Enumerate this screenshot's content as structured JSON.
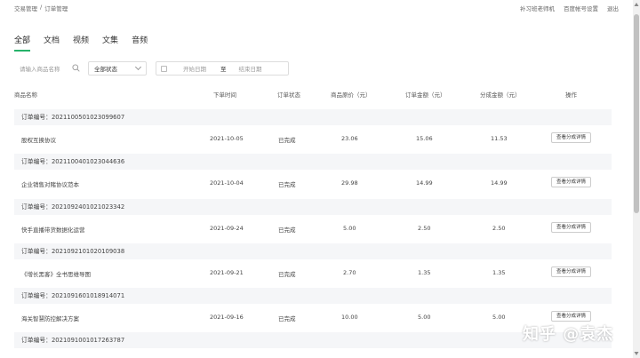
{
  "breadcrumb": {
    "root": "交易管理",
    "sep": "/",
    "current": "订单管理"
  },
  "top_links": [
    "补习班老师机",
    "百度帐号设置",
    "退出"
  ],
  "tabs": [
    {
      "label": "全部",
      "active": true
    },
    {
      "label": "文档"
    },
    {
      "label": "视频"
    },
    {
      "label": "文集"
    },
    {
      "label": "音频"
    }
  ],
  "filters": {
    "search_placeholder": "请输入商品名称",
    "status_select": "全部状态",
    "date_start_placeholder": "开始日期",
    "date_sep": "至",
    "date_end_placeholder": "结束日期"
  },
  "columns": [
    "商品名称",
    "下单时间",
    "订单状态",
    "商品原价（元）",
    "订单金额（元）",
    "分成金额（元）",
    "操作"
  ],
  "orders": [
    {
      "order_no": "订单编号：2021100501023099607",
      "name": "股权互换协议",
      "time": "2021-10-05",
      "status": "已完成",
      "price": "23.06",
      "amount": "15.06",
      "share": "11.53",
      "action": "查看分成详情"
    },
    {
      "order_no": "订单编号：2021100401023044636",
      "name": "企业销售对赌协议范本",
      "time": "2021-10-04",
      "status": "已完成",
      "price": "29.98",
      "amount": "14.99",
      "share": "14.99",
      "action": "查看分成详情"
    },
    {
      "order_no": "订单编号：2021092401021023342",
      "name": "快手直播带货数据化运营",
      "time": "2021-09-24",
      "status": "已完成",
      "price": "5.00",
      "amount": "2.50",
      "share": "2.50",
      "action": "查看分成详情"
    },
    {
      "order_no": "订单编号：2021092101020109038",
      "name": "《增长黑客》全书思维导图",
      "time": "2021-09-21",
      "status": "已完成",
      "price": "2.70",
      "amount": "1.35",
      "share": "1.35",
      "action": "查看分成详情"
    },
    {
      "order_no": "订单编号：2021091601018914071",
      "name": "海关智慧防控解决方案",
      "time": "2021-09-16",
      "status": "已完成",
      "price": "10.00",
      "amount": "5.00",
      "share": "5.00",
      "action": "查看分成详情"
    },
    {
      "order_no": "订单编号：2021091001017263787"
    }
  ],
  "watermark": "知乎 @袁杰",
  "colors": {
    "accent": "#26b36a",
    "group_bg": "#f5f6f8"
  }
}
